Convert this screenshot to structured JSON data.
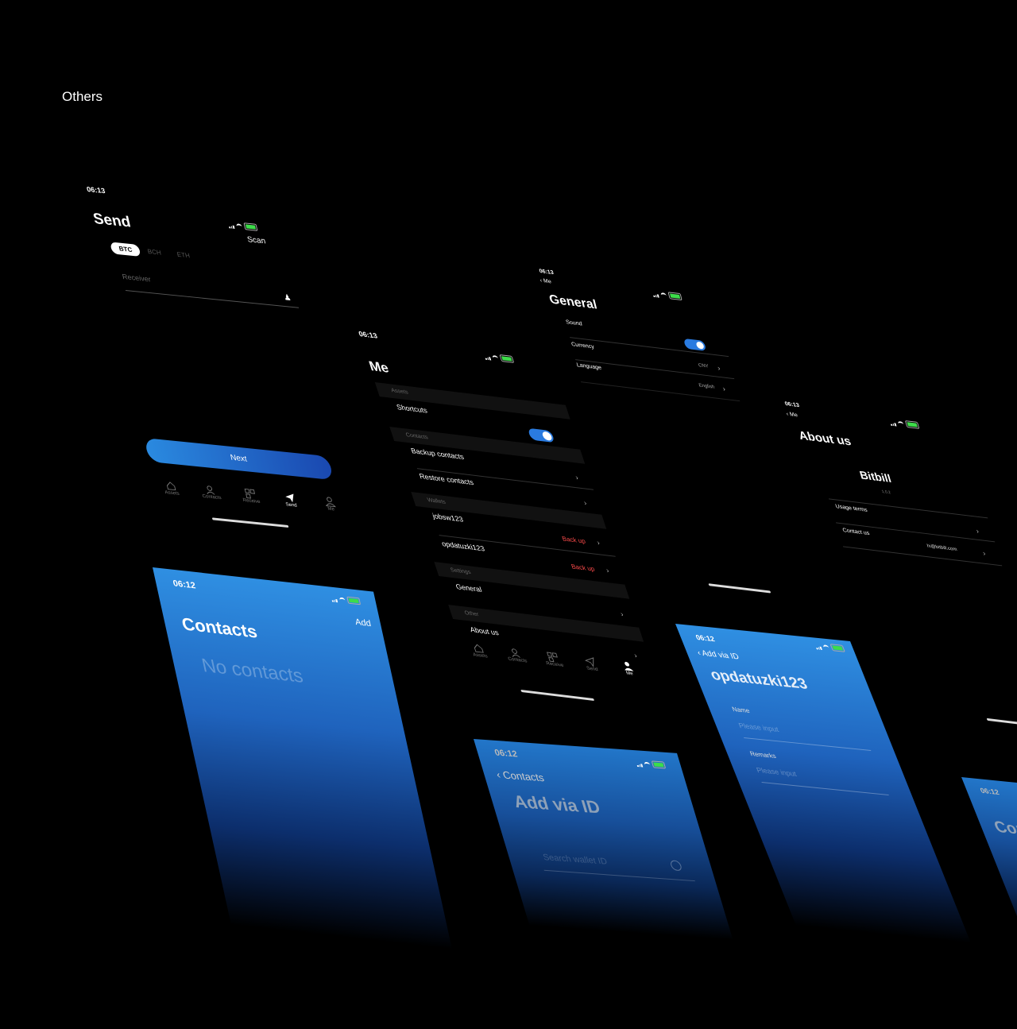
{
  "page": {
    "heading": "Others"
  },
  "colors": {
    "accent": "#2a7be0",
    "danger": "#ff4b4b",
    "battery": "#3ddc4a",
    "background": "#000000"
  },
  "tabbar": {
    "items": [
      "Assets",
      "Contacts",
      "Receive",
      "Send",
      "Me"
    ]
  },
  "send_screen": {
    "time": "06:13",
    "title": "Send",
    "scan": "Scan",
    "coins": [
      "BTC",
      "BCH",
      "ETH"
    ],
    "selected_coin": "BTC",
    "receiver_placeholder": "Receiver",
    "next": "Next",
    "active_tab": "Send"
  },
  "me_screen": {
    "time": "06:13",
    "title": "Me",
    "sections": {
      "assets": "Assets",
      "contacts": "Contacts",
      "wallets": "Wallets",
      "settings": "Settings",
      "other": "Other"
    },
    "shortcuts": "Shortcuts",
    "shortcuts_on": true,
    "backup_contacts": "Backup contacts",
    "restore_contacts": "Restore contacts",
    "wallets": [
      {
        "name": "jobsw123",
        "action": "Back up"
      },
      {
        "name": "opdatuzki123",
        "action": "Back up"
      }
    ],
    "general": "General",
    "about_us": "About us",
    "active_tab": "Me"
  },
  "general_screen": {
    "time": "06:13",
    "back": "Me",
    "title": "General",
    "sound": "Sound",
    "sound_on": true,
    "currency": "Currency",
    "currency_value": "CNY",
    "language": "Language",
    "language_value": "English"
  },
  "about_screen": {
    "time": "06:13",
    "back": "Me",
    "title": "About us",
    "app_name": "Bitbill",
    "version": "1.0.2",
    "usage_terms": "Usage terms",
    "contact_us": "Contact us",
    "contact_email": "hi@bitbill.com"
  },
  "contacts_screen": {
    "time": "06:12",
    "title": "Contacts",
    "add": "Add",
    "empty": "No contacts"
  },
  "add_via_id_screen": {
    "time": "06:12",
    "back": "Contacts",
    "title": "Add via ID",
    "search_placeholder": "Search wallet ID"
  },
  "contact_detail_screen": {
    "time": "06:12",
    "back": "Add via ID",
    "title": "opdatuzki123",
    "name_label": "Name",
    "name_placeholder": "Please input",
    "remarks_label": "Remarks",
    "remarks_placeholder": "Please input"
  },
  "contacts_partial_screen": {
    "time": "06:12",
    "title": "Contacts"
  }
}
